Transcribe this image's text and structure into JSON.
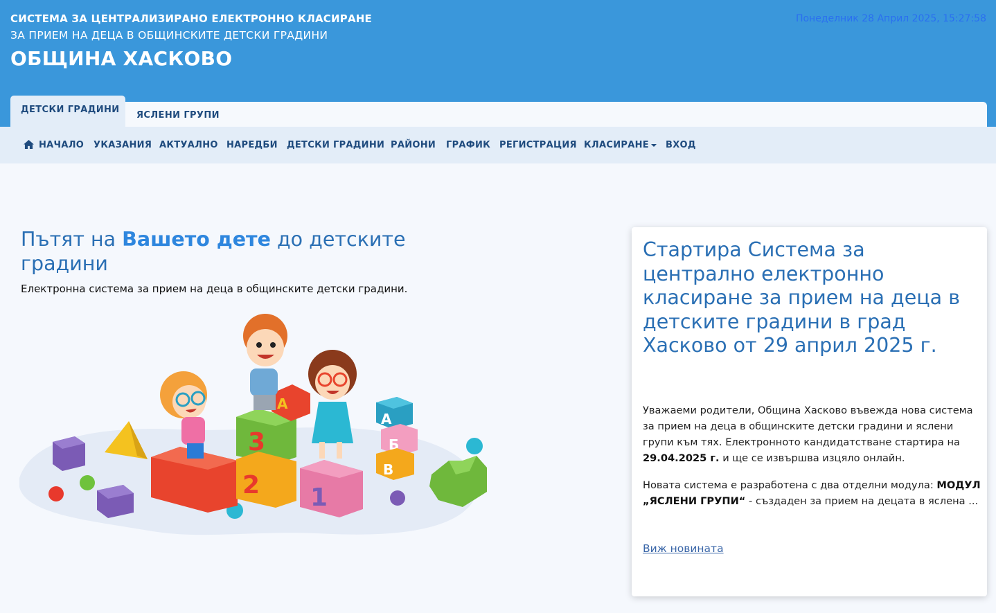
{
  "header": {
    "line1": "СИСТЕМА ЗА ЦЕНТРАЛИЗИРАНО ЕЛЕКТРОННО КЛАСИРАНЕ",
    "line2": "ЗА ПРИЕМ НА ДЕЦА В ОБЩИНСКИТЕ ДЕТСКИ ГРАДИНИ",
    "title": "ОБЩИНА ХАСКОВО",
    "datetime": "Понеделник 28 Април 2025, 15:27:58",
    "datetime_color": "#2a6ff0",
    "bg_color": "#3a97db"
  },
  "tabs": [
    {
      "label": "ДЕТСКИ ГРАДИНИ",
      "active": true
    },
    {
      "label": "ЯСЛЕНИ ГРУПИ",
      "active": false
    }
  ],
  "nav": {
    "home": "НАЧАЛО",
    "instructions": "УКАЗАНИЯ",
    "current": "АКТУАЛНО",
    "regulations": "НАРЕДБИ",
    "kindergartens": "ДЕТСКИ ГРАДИНИ",
    "districts": "РАЙОНИ",
    "schedule": "ГРАФИК",
    "registration": "РЕГИСТРАЦИЯ",
    "ranking": "КЛАСИРАНЕ",
    "login": "ВХОД"
  },
  "hero": {
    "title_pre": "Пътят на ",
    "title_highlight": "Вашето дете",
    "title_post": " до детските градини",
    "subtitle": "Електронна система за прием на деца в общинските детски градини."
  },
  "illustration": {
    "block_letters": [
      "А",
      "3",
      "2",
      "1",
      "А",
      "Б",
      "В"
    ]
  },
  "news": {
    "title": "Стартира Система за централно електронно класиране за прием на деца в детските градини в град Хасково от 29 април 2025 г.",
    "p1_pre": "Уважаеми родители, Община Хасково въвежда нова система за прием на деца в общинските детски градини и яслени групи към тях. Електронното кандидатстване стартира на ",
    "p1_bold": "29.04.2025 г.",
    "p1_post": " и ще се извършва изцяло онлайн.",
    "p2_pre": "Новата система е разработена с два отделни модула: ",
    "p2_bold": "МОДУЛ „ЯСЛЕНИ ГРУПИ“",
    "p2_post": " - създаден за прием на децата в яслена   ...",
    "link": "Виж новината"
  }
}
